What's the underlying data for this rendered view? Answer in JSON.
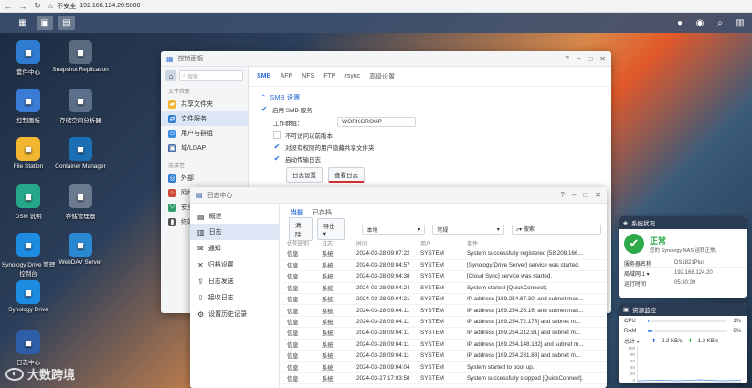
{
  "browser": {
    "security_label": "不安全",
    "url": "192.168.124.20:5000"
  },
  "desktop": {
    "icons": [
      {
        "label": "套件中心",
        "icon": "package-center-icon",
        "color": "#2f7dd1"
      },
      {
        "label": "Snapshot Replication",
        "icon": "snapshot-icon",
        "color": "#5a6b80"
      },
      {
        "label": "控制面板",
        "icon": "control-panel-icon",
        "color": "#3a7bd5"
      },
      {
        "label": "存储空间分析器",
        "icon": "storage-analyzer-icon",
        "color": "#5b6f8a"
      },
      {
        "label": "File Station",
        "icon": "folder-icon",
        "color": "#f2b630"
      },
      {
        "label": "Container Manager",
        "icon": "container-icon",
        "color": "#1a6fb5"
      },
      {
        "label": "DSM 说明",
        "icon": "help-icon",
        "color": "#25a88a"
      },
      {
        "label": "存储管理器",
        "icon": "storage-manager-icon",
        "color": "#6b7a8e"
      },
      {
        "label": "Synology Drive 管理控制台",
        "icon": "drive-admin-icon",
        "color": "#1d8be0"
      },
      {
        "label": "WebDAV Server",
        "icon": "webdav-icon",
        "color": "#2a88d0"
      },
      {
        "label": "Synology Drive",
        "icon": "drive-icon",
        "color": "#1d8be0"
      },
      {
        "label": "日志中心",
        "icon": "log-center-icon",
        "color": "#2f5ea8"
      }
    ]
  },
  "control_panel": {
    "title": "控制面板",
    "search_placeholder": "搜索",
    "sidebar": {
      "group1": "文件共享",
      "items1": [
        "共享文件夹",
        "文件服务",
        "用户与群组",
        "域/LDAP"
      ],
      "group2": "连接性",
      "items2": [
        "外部",
        "网络",
        "安全",
        "终端"
      ]
    },
    "tabs": [
      "SMB",
      "AFP",
      "NFS",
      "FTP",
      "rsync",
      "高级设置"
    ],
    "section_title": "SMB 设置",
    "enable_smb": "启用 SMB 服务",
    "workgroup_label": "工作群组：",
    "workgroup_value": "WORKGROUP",
    "opt1": "不可访问以前版本",
    "opt2": "对没有权限的用户隐藏共享文件夹",
    "opt3": "启动传输日志",
    "btn_log_settings": "日志设置",
    "btn_view_logs": "查看日志"
  },
  "log_center": {
    "title": "日志中心",
    "sidebar": [
      "概述",
      "日志",
      "通知",
      "归档设置",
      "日志发送",
      "接收日志",
      "设置历史记录"
    ],
    "tabs": [
      "当前",
      "已存档"
    ],
    "toolbar": {
      "clear": "清除",
      "export": "导出",
      "source": "本地",
      "level": "常规",
      "search_placeholder": "搜索"
    },
    "columns": [
      "优先级别",
      "日志",
      "时间",
      "用户",
      "事件"
    ],
    "rows": [
      [
        "信息",
        "系统",
        "2024-03-28 09:07:22",
        "SYSTEM",
        "System successfully registered [58.208.166..."
      ],
      [
        "信息",
        "系统",
        "2024-03-28 09:04:57",
        "SYSTEM",
        "[Synology Drive Server] service was started."
      ],
      [
        "信息",
        "系统",
        "2024-03-28 09:04:38",
        "SYSTEM",
        "[Cloud Sync] service was started."
      ],
      [
        "信息",
        "系统",
        "2024-03-28 09:04:24",
        "SYSTEM",
        "System started [QuickConnect]."
      ],
      [
        "信息",
        "系统",
        "2024-03-28 09:04:21",
        "SYSTEM",
        "IP address [169.254.67.30] and subnet mas..."
      ],
      [
        "信息",
        "系统",
        "2024-03-28 09:04:11",
        "SYSTEM",
        "IP address [169.254.26.16] and subnet mas..."
      ],
      [
        "信息",
        "系统",
        "2024-03-28 09:04:11",
        "SYSTEM",
        "IP address [169.254.72.178] and subnet m..."
      ],
      [
        "信息",
        "系统",
        "2024-03-28 09:04:11",
        "SYSTEM",
        "IP address [169.254.212.91] and subnet m..."
      ],
      [
        "信息",
        "系统",
        "2024-03-28 09:04:11",
        "SYSTEM",
        "IP address [169.254.148.182] and subnet m..."
      ],
      [
        "信息",
        "系统",
        "2024-03-28 09:04:11",
        "SYSTEM",
        "IP address [169.254.231.88] and subnet m..."
      ],
      [
        "信息",
        "系统",
        "2024-03-28 09:04:04",
        "SYSTEM",
        "System started to boot up."
      ],
      [
        "信息",
        "系统",
        "2024-03-27 17:03:58",
        "SYSTEM",
        "System successfully stopped [QuickConnect]."
      ]
    ]
  },
  "system_health": {
    "title": "系统状况",
    "status": "正常",
    "status_desc": "您的 Synology NAS 运转正常。",
    "server_name_label": "服务器名称",
    "server_name": "DS1821Plus",
    "lan_label": "局域网 1 ▾",
    "lan_ip": "192.168.124.20",
    "uptime_label": "运行时间",
    "uptime": "05:30:39"
  },
  "resource_monitor": {
    "title": "资源监控",
    "cpu_label": "CPU",
    "cpu_value": "1%",
    "cpu_fraction": 0.01,
    "ram_label": "RAM",
    "ram_value": "6%",
    "ram_fraction": 0.06,
    "total_label": "总计 ▾",
    "upload": "2.2 KB/s",
    "download": "1.3 KB/s",
    "y_ticks": [
      "100",
      "80",
      "60",
      "40",
      "20",
      "0"
    ]
  },
  "watermark": "大数跨境",
  "colors": {
    "accent": "#2d6fd8",
    "ok_green": "#2faa4a"
  }
}
